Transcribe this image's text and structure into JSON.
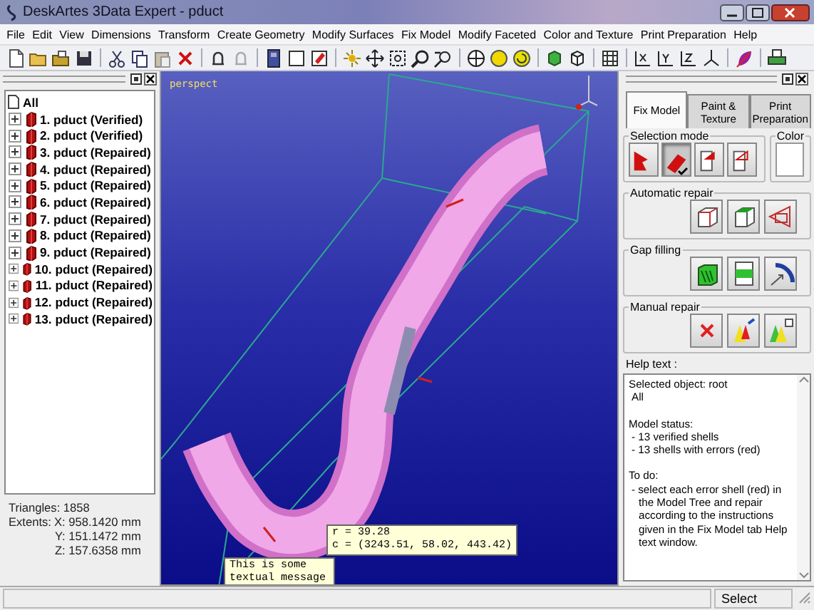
{
  "window": {
    "title": "DeskArtes 3Data Expert - pduct"
  },
  "menu": [
    "File",
    "Edit",
    "View",
    "Dimensions",
    "Transform",
    "Create Geometry",
    "Modify Surfaces",
    "Fix Model",
    "Modify Faceted",
    "Color and Texture",
    "Print Preparation",
    "Help"
  ],
  "tree": {
    "label": "All",
    "expanded": true,
    "children": [
      {
        "label": "1. pduct (Verified)",
        "expanded": false
      },
      {
        "label": "2. pduct (Verified)",
        "expanded": false
      },
      {
        "label": "3. pduct (Repaired)",
        "expanded": false
      },
      {
        "label": "4. pduct (Repaired)",
        "expanded": false
      },
      {
        "label": "5. pduct (Repaired)",
        "expanded": false
      },
      {
        "label": "6. pduct (Repaired)",
        "expanded": false
      },
      {
        "label": "7. pduct (Repaired)",
        "expanded": false
      },
      {
        "label": "8. pduct (Repaired)",
        "expanded": false
      },
      {
        "label": "9. pduct (Repaired)",
        "expanded": false
      },
      {
        "label": "10. pduct (Repaired)",
        "expanded": false
      },
      {
        "label": "11. pduct (Repaired)",
        "expanded": false
      },
      {
        "label": "12. pduct (Repaired)",
        "expanded": false
      },
      {
        "label": "13. pduct (Repaired)",
        "expanded": false
      }
    ]
  },
  "model_info": {
    "triangles": "Triangles: 1858",
    "extents_label": "Extents:",
    "extents": [
      "X: 958.1420 mm",
      "Y: 151.1472 mm",
      "Z: 157.6358 mm"
    ]
  },
  "viewport": {
    "view_label": "perspect",
    "measure_tooltip": [
      "r = 39.28",
      "c = (3243.51, 58.02, 443.42)"
    ],
    "message": "This is some textual message"
  },
  "panel": {
    "tabs": [
      {
        "label": "Fix Model",
        "selected": true
      },
      {
        "label": "Paint & Texture",
        "selected": false
      },
      {
        "label": "Print Preparation",
        "selected": false
      }
    ],
    "selection_title": "Selection mode",
    "selection_buttons": [
      {
        "selected": false
      },
      {
        "selected": true
      },
      {
        "selected": false
      },
      {
        "selected": false
      }
    ],
    "color_title": "Color",
    "groups": [
      {
        "kind": "automatic_repair",
        "title": "Automatic repair"
      },
      {
        "kind": "gap_filling",
        "title": "Gap filling"
      },
      {
        "kind": "manual_repair",
        "title": "Manual repair"
      }
    ],
    "help_label": "Help text :",
    "help_blocks": [
      {
        "heading": "Selected object: root",
        "items": [
          "All"
        ]
      },
      {
        "heading": "Model status:",
        "items": [
          "- 13 verified shells",
          "- 13 shells with errors (red)"
        ]
      },
      {
        "heading": "To do:",
        "items": [
          "- select each error shell (red) in the Model Tree and repair according to the instructions given in the Fix Model tab Help text window."
        ]
      }
    ]
  },
  "status_bar": {
    "mode": "Select"
  }
}
